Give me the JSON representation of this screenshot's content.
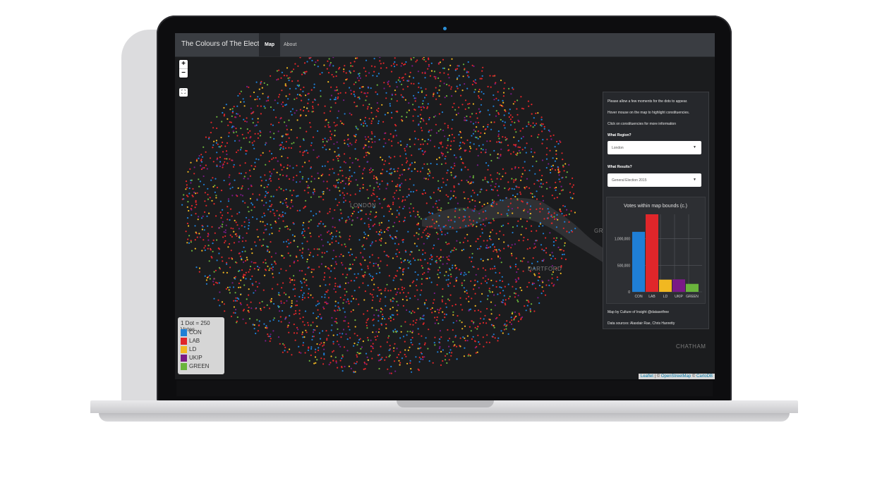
{
  "navbar": {
    "title": "The Colours of The Electorate",
    "tabs": [
      {
        "label": "Map",
        "active": true
      },
      {
        "label": "About",
        "active": false
      }
    ]
  },
  "map": {
    "zoom_in": "+",
    "zoom_out": "−",
    "fullscreen": "⛶",
    "labels": {
      "london": "LONDON",
      "dartford": "DARTFORD",
      "chatham": "CHATHAM",
      "gra": "GRA"
    }
  },
  "panel": {
    "info_lines": [
      "Please allow a few moments for the dots to appear.",
      "Hover mouse on the map to highlight constituencies.",
      "Click on constituencies for more information"
    ],
    "region_label": "What Region?",
    "region_value": "London",
    "results_label": "What Results?",
    "results_value": "General Election 2015",
    "credit": "Map by Culture of Insight @datasetfree",
    "sources": "Data sources: Alasdair Rae, Chris Hanretty"
  },
  "chart_data": {
    "type": "bar",
    "title": "Votes within map bounds (c.)",
    "categories": [
      "CON",
      "LAB",
      "LD",
      "UKIP",
      "GREEN"
    ],
    "values": [
      1130000,
      1460000,
      230000,
      235000,
      150000
    ],
    "colors": [
      "#1f7fd6",
      "#e0262a",
      "#f1b821",
      "#7a1a86",
      "#6ab43c"
    ],
    "yticks": [
      "0",
      "500,000",
      "1,000,000"
    ],
    "ylim": [
      0,
      1460000
    ],
    "grid": true
  },
  "legend": {
    "title": "1 Dot = 250 Votes",
    "items": [
      {
        "label": "CON",
        "color": "#1f7fd6"
      },
      {
        "label": "LAB",
        "color": "#e0262a"
      },
      {
        "label": "LD",
        "color": "#f1b821"
      },
      {
        "label": "UKIP",
        "color": "#7a1a86"
      },
      {
        "label": "GREEN",
        "color": "#6ab43c"
      }
    ]
  },
  "attribution": {
    "leaflet": "Leaflet",
    "sep": " | © ",
    "osm": "OpenStreetMap",
    "sep2": " © ",
    "carto": "CartoDB"
  }
}
